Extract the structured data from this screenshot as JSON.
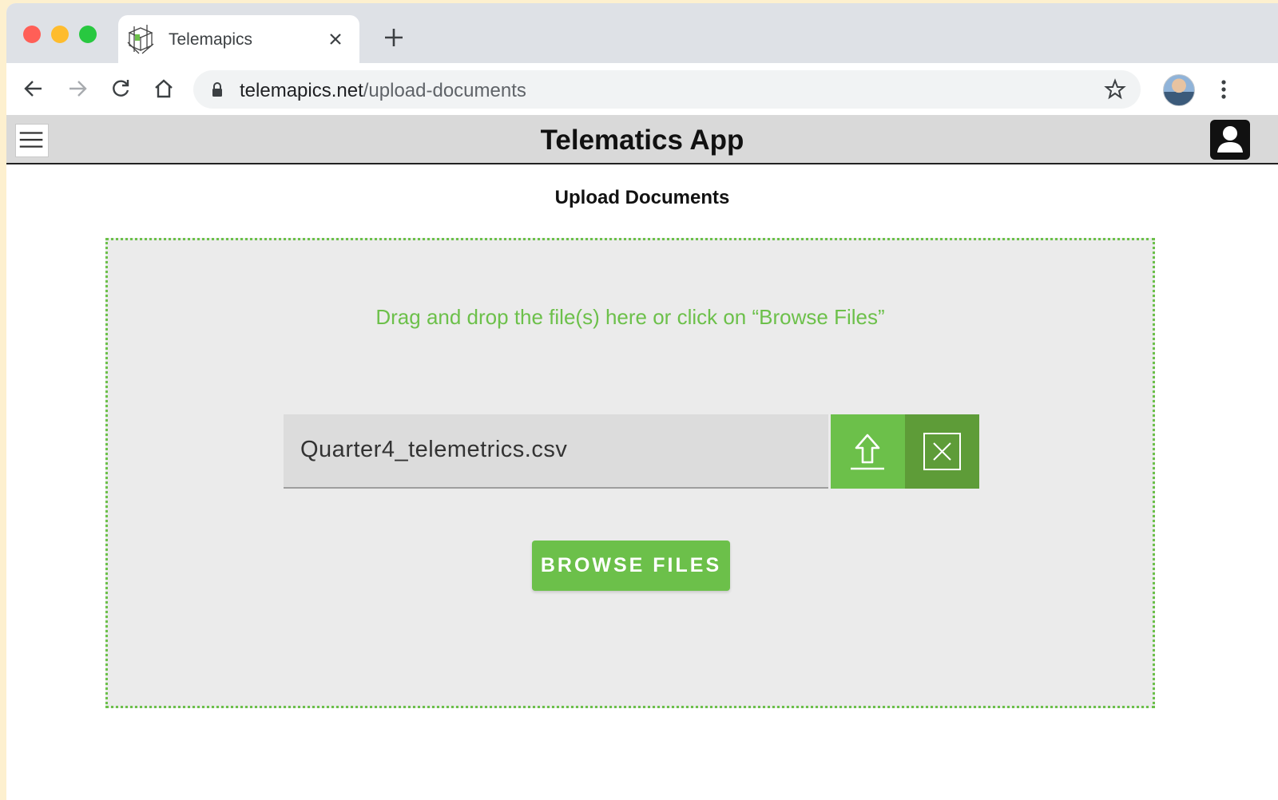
{
  "browser": {
    "tab_title": "Telemapics",
    "url_domain": "telemapics.net",
    "url_path": "/upload-documents"
  },
  "app": {
    "title": "Telematics App"
  },
  "page": {
    "heading": "Upload Documents",
    "drop_hint": "Drag and drop the file(s) here or click on “Browse Files”",
    "selected_file": "Quarter4_telemetrics.csv",
    "browse_label": "BROWSE FILES"
  },
  "colors": {
    "accent": "#6cc04a",
    "accent_dark": "#5e9c38",
    "header_bg": "#d9d9d9",
    "dropzone_bg": "#ebebeb"
  },
  "icons": [
    "telemapics-logo-icon",
    "close-icon",
    "plus-icon",
    "back-arrow-icon",
    "forward-arrow-icon",
    "reload-icon",
    "home-icon",
    "lock-icon",
    "star-icon",
    "profile-avatar",
    "more-vert-icon",
    "hamburger-icon",
    "user-icon",
    "upload-icon",
    "clear-icon"
  ]
}
